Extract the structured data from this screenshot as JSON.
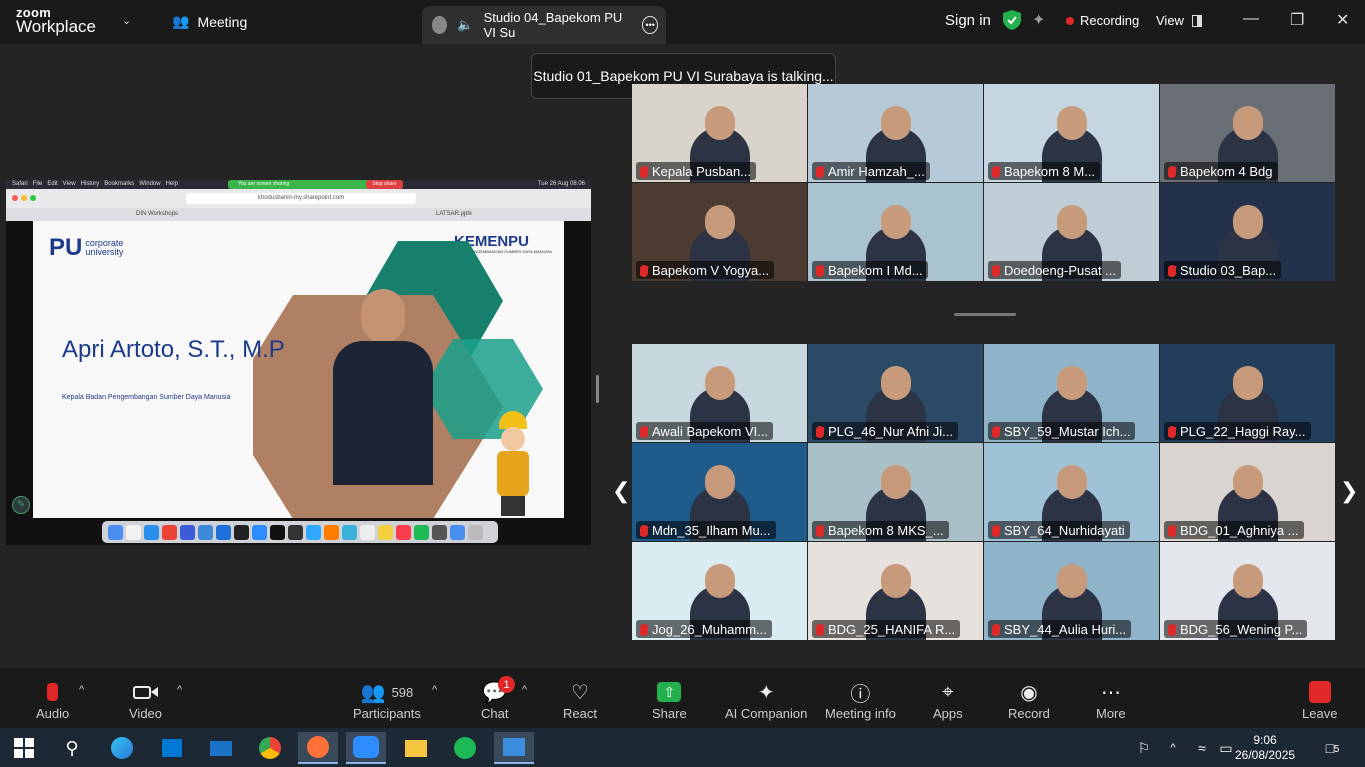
{
  "app": {
    "logo_top": "zoom",
    "logo_bottom": "Workplace",
    "meeting_label": "Meeting",
    "tab_title": "Studio 04_Bapekom PU VI Su",
    "sign_in": "Sign in",
    "recording": "Recording",
    "view": "View"
  },
  "tooltip": "Studio 01_Bapekom PU VI Surabaya is talking...",
  "share": {
    "mac_menu": "Safari   File   Edit   View   History   Bookmarks   Window   Help",
    "mac_clock": "Tue 26 Aug  08.06",
    "sharing_label": "You are screen sharing",
    "stop_share": "Stop share",
    "url": "khodusbanin-my.sharepoint.com",
    "tab1": "DIN Workshops",
    "tab2": "LATSAR.pptx",
    "logo_pu": "PU",
    "logo_corp": "corporate",
    "logo_univ": "university",
    "kemen_a": "KEMEN",
    "kemen_b": "PU",
    "kemen_sub": "BADAN PENGEMBANGAN SUMBER DAYA MANUSIA",
    "speaker": "Apri Artoto, S.T., M.P",
    "role": "Kepala Badan Pengembangan Sumber Daya Manusia"
  },
  "gallery_top": [
    {
      "name": "Kepala Pusban...",
      "bg": "#d8d4cc"
    },
    {
      "name": "Amir Hamzah_...",
      "bg": "#b6c9d8"
    },
    {
      "name": "Bapekom 8 M...",
      "bg": "#c6d6e0"
    },
    {
      "name": "Bapekom 4 Bdg",
      "bg": "#6a6f76"
    },
    {
      "name": "Bapekom V Yogya...",
      "bg": "#4c3b30"
    },
    {
      "name": "Bapekom I Md...",
      "bg": "#aac3d1"
    },
    {
      "name": "Doedoeng-Pusat ...",
      "bg": "#bfcdd6"
    },
    {
      "name": "Studio 03_Bap...",
      "bg": "#23324a"
    }
  ],
  "gallery_bottom": [
    {
      "name": "Awali Bapekom VI...",
      "bg": "#c7d7de"
    },
    {
      "name": "PLG_46_Nur Afni Ji...",
      "bg": "#2b4a66"
    },
    {
      "name": "SBY_59_Mustar Ich...",
      "bg": "#8fb4c9"
    },
    {
      "name": "PLG_22_Haggi Ray...",
      "bg": "#243f5c"
    },
    {
      "name": "Mdn_35_Ilham Mu...",
      "bg": "#1e5a8a"
    },
    {
      "name": "Bapekom 8 MKS_...",
      "bg": "#aac0c8"
    },
    {
      "name": "SBY_64_Nurhidayati",
      "bg": "#9fc2d6"
    },
    {
      "name": "BDG_01_Aghniya ...",
      "bg": "#d9d4cf"
    },
    {
      "name": "Jog_26_Muhamm...",
      "bg": "#d9ecf2"
    },
    {
      "name": "BDG_25_HANIFA R...",
      "bg": "#e6e1dc"
    },
    {
      "name": "SBY_44_Aulia Huri...",
      "bg": "#8fb4c9"
    },
    {
      "name": "BDG_56_Wening P...",
      "bg": "#e3e6ea"
    }
  ],
  "toolbar": {
    "audio": "Audio",
    "video": "Video",
    "participants": "Participants",
    "participants_count": "598",
    "chat": "Chat",
    "chat_badge": "1",
    "react": "React",
    "share": "Share",
    "ai": "AI Companion",
    "info": "Meeting info",
    "apps": "Apps",
    "record": "Record",
    "more": "More",
    "leave": "Leave"
  },
  "taskbar": {
    "time": "9:06",
    "date": "26/08/2025",
    "notif": "5"
  },
  "colors": {
    "accent_green": "#22b14c",
    "danger": "#e02828",
    "kemen_blue": "#1d3a8a",
    "kemen_gold": "#e8a400"
  }
}
